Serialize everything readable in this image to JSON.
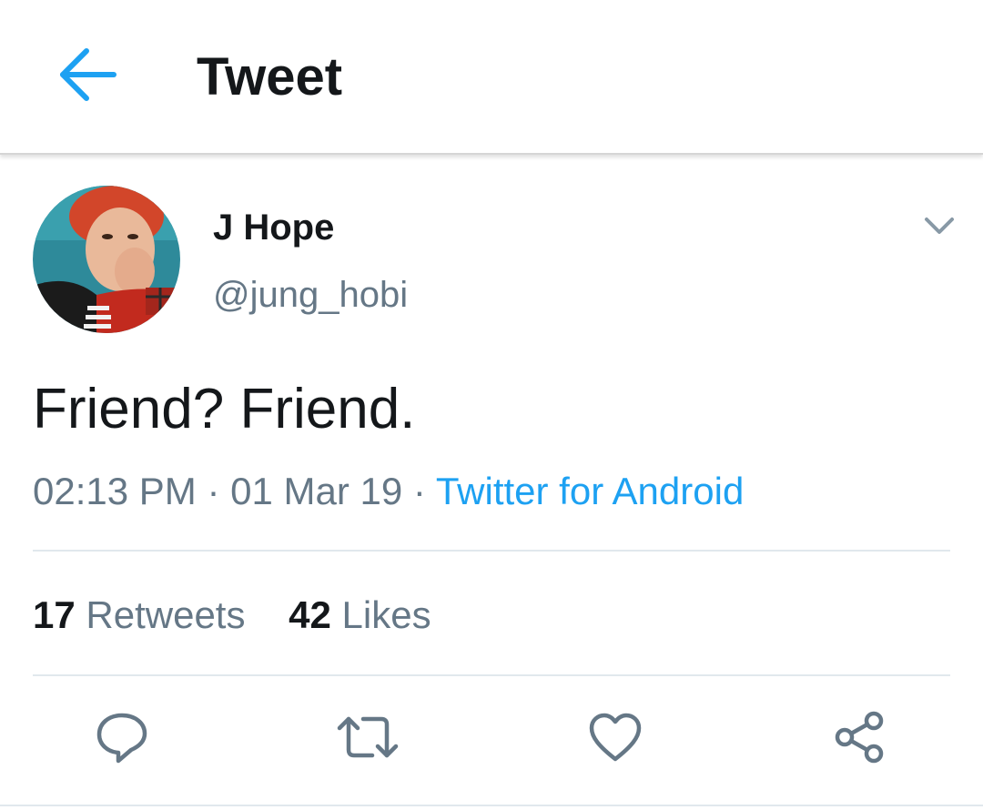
{
  "header": {
    "title": "Tweet",
    "back_icon": "arrow-left-icon",
    "accent_color": "#1da1f2"
  },
  "tweet": {
    "author": {
      "display_name": "J Hope",
      "handle": "@jung_hobi",
      "avatar": "profile-photo"
    },
    "menu_icon": "chevron-down-icon",
    "text": "Friend? Friend.",
    "time": "02:13 PM",
    "separator": "·",
    "date": "01 Mar 19",
    "source": "Twitter for Android",
    "stats": {
      "retweets_count": "17",
      "retweets_label": "Retweets",
      "likes_count": "42",
      "likes_label": "Likes"
    },
    "actions": [
      {
        "name": "reply",
        "icon": "reply-icon"
      },
      {
        "name": "retweet",
        "icon": "retweet-icon"
      },
      {
        "name": "like",
        "icon": "heart-icon"
      },
      {
        "name": "share",
        "icon": "share-icon"
      }
    ]
  },
  "colors": {
    "text_primary": "#14171a",
    "text_secondary": "#657786",
    "link": "#1da1f2",
    "divider": "#e1e8ed"
  }
}
